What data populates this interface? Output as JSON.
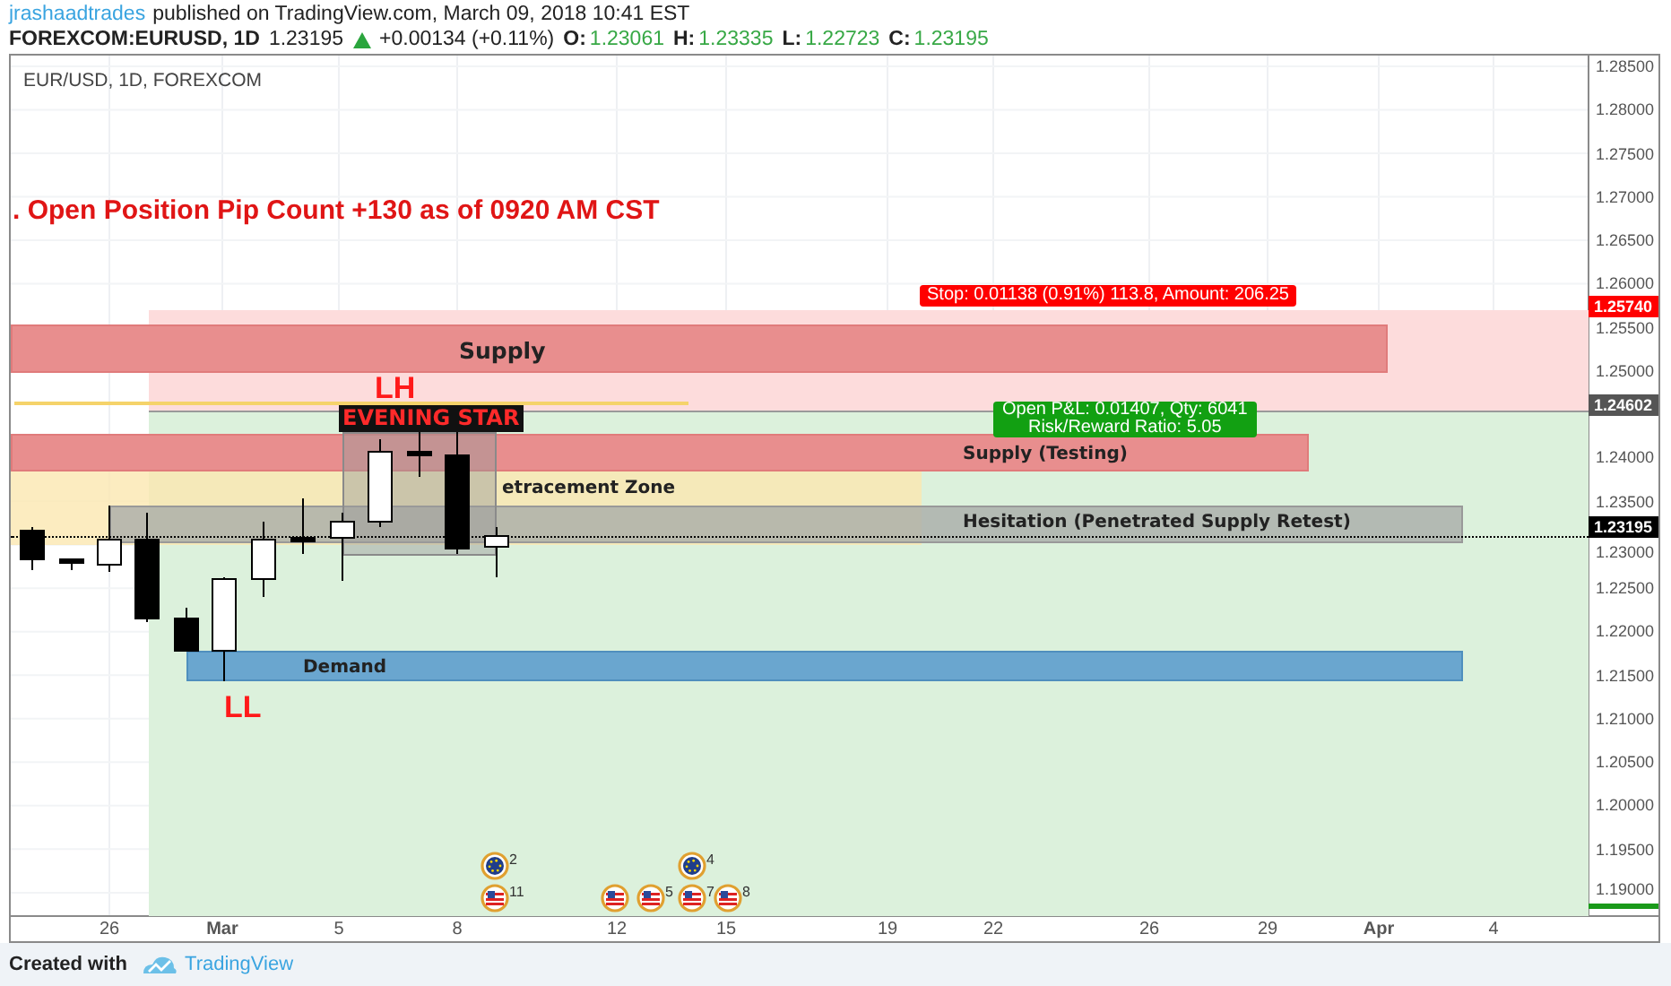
{
  "header": {
    "author": "jrashaadtrades",
    "published": "published on TradingView.com, March 09, 2018 10:41 EST"
  },
  "ticker": {
    "symbol": "FOREXCOM:EURUSD, 1D",
    "last": "1.23195",
    "change": "+0.00134 (+0.11%)",
    "ohlc": [
      {
        "label": "O:",
        "value": "1.23061"
      },
      {
        "label": "H:",
        "value": "1.23335"
      },
      {
        "label": "L:",
        "value": "1.22723"
      },
      {
        "label": "C:",
        "value": "1.23195"
      }
    ]
  },
  "chart": {
    "legend": "EUR/USD, 1D, FOREXCOM",
    "note": ". Open Position Pip Count +130 as of 0920 AM CST",
    "zones": [
      {
        "kind": "supply",
        "label": "Supply"
      },
      {
        "kind": "supply",
        "label": "Supply (Testing)"
      },
      {
        "kind": "retracement",
        "label": "etracement Zone"
      },
      {
        "kind": "hesitation",
        "label": "Hesitation (Penetrated Supply Retest)"
      },
      {
        "kind": "demand",
        "label": "Demand"
      }
    ],
    "markers": [
      "LH",
      "LL"
    ],
    "pattern_label": "EVENING STAR",
    "stop_label": "Stop: 0.01138 (0.91%) 113.8, Amount: 206.25",
    "target_label": [
      "Open P&L: 0.01407, Qty: 6041",
      "Risk/Reward Ratio: 5.05"
    ],
    "price_axis": [
      "1.28500",
      "1.28000",
      "1.27500",
      "1.27000",
      "1.26500",
      "1.26000",
      "1.25500",
      "1.25000",
      "1.24000",
      "1.23500",
      "1.23000",
      "1.22500",
      "1.22000",
      "1.21500",
      "1.21000",
      "1.20500",
      "1.20000",
      "1.19500",
      "1.19000"
    ],
    "price_tags": [
      {
        "value": "1.25740",
        "color": "#ff0000"
      },
      {
        "value": "1.24602",
        "color": "#555555"
      },
      {
        "value": "1.23195",
        "color": "#000000"
      }
    ],
    "date_axis": [
      {
        "label": "26",
        "kind": "day"
      },
      {
        "label": "Mar",
        "kind": "month"
      },
      {
        "label": "5",
        "kind": "day"
      },
      {
        "label": "8",
        "kind": "day"
      },
      {
        "label": "12",
        "kind": "day"
      },
      {
        "label": "15",
        "kind": "day"
      },
      {
        "label": "19",
        "kind": "day"
      },
      {
        "label": "22",
        "kind": "day"
      },
      {
        "label": "26",
        "kind": "day"
      },
      {
        "label": "29",
        "kind": "day"
      },
      {
        "label": "Apr",
        "kind": "month"
      },
      {
        "label": "4",
        "kind": "day"
      }
    ],
    "events": [
      {
        "kind": "eu",
        "count": "2"
      },
      {
        "kind": "us",
        "count": "11"
      },
      {
        "kind": "us"
      },
      {
        "kind": "us",
        "count": "5"
      },
      {
        "kind": "eu",
        "count": "4"
      },
      {
        "kind": "us",
        "count": "7"
      },
      {
        "kind": "us",
        "count": "8"
      }
    ]
  },
  "footer": {
    "text": "Created with",
    "brand": "TradingView"
  }
}
